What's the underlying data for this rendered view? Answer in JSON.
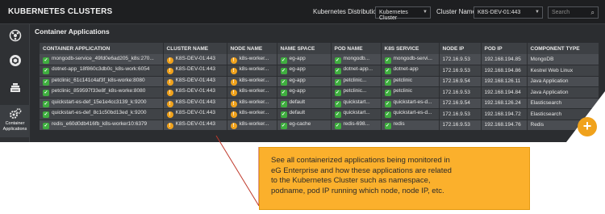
{
  "app": {
    "title": "KUBERNETES CLUSTERS",
    "distribution_label": "Kubernetes Distribution",
    "distribution_value": "Kubernetes Cluster",
    "cluster_label": "Cluster Name",
    "cluster_value": "K8S-DEV-01:443",
    "search_placeholder": "Search"
  },
  "sidebar": {
    "items": [
      {
        "icon": "dashboard-icon",
        "label": ""
      },
      {
        "icon": "hexagon-node-icon",
        "label": ""
      },
      {
        "icon": "server-stack-icon",
        "label": ""
      },
      {
        "icon": "gears-icon",
        "label": "Container Applications",
        "label_line1": "Container",
        "label_line2": "Applications",
        "active": true
      }
    ]
  },
  "section": {
    "title": "Container Applications"
  },
  "table": {
    "headers": [
      "CONTAINER APPLICATION",
      "CLUSTER NAME",
      "NODE NAME",
      "NAME SPACE",
      "POD NAME",
      "K8S SERVICE",
      "NODE IP",
      "POD IP",
      "COMPONENT TYPE"
    ],
    "rows": [
      {
        "app": "mongodb-service_49fd0e6ad205_k8s:270...",
        "app_status": "ok",
        "cluster": "K8S-DEV-01:443",
        "node": "k8s-worker...",
        "namespace": "eg-app",
        "pod": "mongodb...",
        "service": "mongodb-servi...",
        "node_ip": "172.16.9.53",
        "pod_ip": "192.168.194.85",
        "type": "MongoDB"
      },
      {
        "app": "dotnet-app_18f860c3db0c_k8s-work:6054",
        "app_status": "ok",
        "cluster": "K8S-DEV-01:443",
        "node": "k8s-worker...",
        "namespace": "eg-app",
        "pod": "dotnet-app...",
        "service": "dotnet-app",
        "node_ip": "172.16.9.53",
        "pod_ip": "192.168.194.86",
        "type": "Kestrel Web Linux"
      },
      {
        "app": "petclinic_61c141c4af3f_k8s-worke:8080",
        "app_status": "ok",
        "cluster": "K8S-DEV-01:443",
        "node": "k8s-worker...",
        "namespace": "eg-app",
        "pod": "petclinic...",
        "service": "petclinic",
        "node_ip": "172.16.9.54",
        "pod_ip": "192.168.126.11",
        "type": "Java Application"
      },
      {
        "app": "petclinic_859597f33e8f_k8s-worke:8080",
        "app_status": "ok",
        "cluster": "K8S-DEV-01:443",
        "node": "k8s-worker...",
        "namespace": "eg-app",
        "pod": "petclinic...",
        "service": "petclinic",
        "node_ip": "172.16.9.53",
        "pod_ip": "192.168.194.84",
        "type": "Java Application"
      },
      {
        "app": "quickstart-es-def_15e1e4cc3139_k:9200",
        "app_status": "ok",
        "cluster": "K8S-DEV-01:443",
        "node": "k8s-worker...",
        "namespace": "default",
        "pod": "quickstart...",
        "service": "quickstart-es-d...",
        "node_ip": "172.16.9.54",
        "pod_ip": "192.168.126.24",
        "type": "Elasticsearch"
      },
      {
        "app": "quickstart-es-def_8c1c50bd13ed_k:9200",
        "app_status": "ok",
        "cluster": "K8S-DEV-01:443",
        "node": "k8s-worker...",
        "namespace": "default",
        "pod": "quickstart...",
        "service": "quickstart-es-d...",
        "node_ip": "172.16.9.53",
        "pod_ip": "192.168.194.72",
        "type": "Elasticsearch"
      },
      {
        "app": "redis_e60d0db416fb_k8s-worker10:6379",
        "app_status": "ok",
        "cluster": "K8S-DEV-01:443",
        "node": "k8s-worker...",
        "namespace": "eg-cache",
        "pod": "redis-698...",
        "service": "redis",
        "node_ip": "172.16.9.53",
        "pod_ip": "192.168.194.76",
        "type": "Redis"
      }
    ]
  },
  "callout": {
    "text": "See all containerized applications being monitored in eG Enterprise and how these applications are related to the Kubernetes Cluster such as namespace, podname, pod IP running which node, node IP, etc.",
    "lines": [
      "See all containerized applications being monitored in",
      "eG Enterprise and how these applications are related",
      "to the Kubernetes Cluster such as namespace,",
      "podname, pod IP running which node, node IP, etc."
    ]
  },
  "colors": {
    "ok": "#3fae3f",
    "warn": "#f0a21c",
    "callout_bg": "#fbb02c",
    "pointer": "#c0392b"
  }
}
